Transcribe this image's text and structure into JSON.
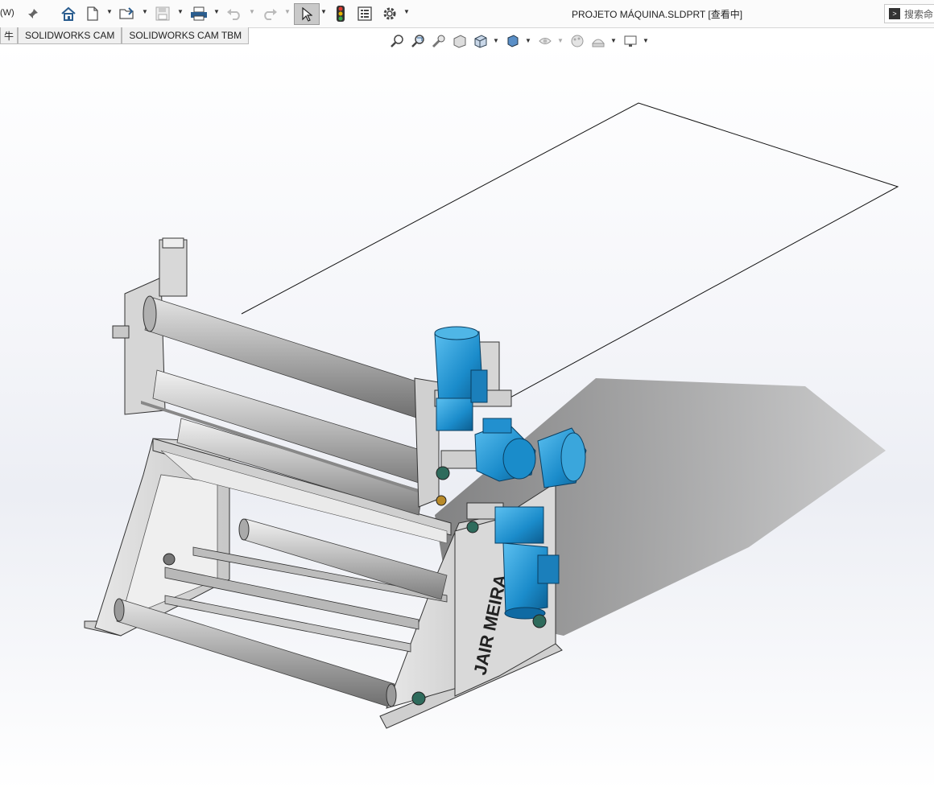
{
  "app": {
    "menu_fragment": "(W)",
    "document_title": "PROJETO MÁQUINA.SLDPRT [查看中]",
    "search_placeholder": "搜索命"
  },
  "tabs": [
    {
      "label": "牛"
    },
    {
      "label": "SOLIDWORKS CAM"
    },
    {
      "label": "SOLIDWORKS CAM TBM"
    }
  ],
  "toolbar_icons": [
    "pin-icon",
    "home-icon",
    "new-document-icon",
    "open-folder-icon",
    "save-icon",
    "print-icon",
    "undo-icon",
    "redo-icon",
    "select-cursor-icon",
    "rebuild-traffic-light-icon",
    "file-properties-icon",
    "options-gear-icon"
  ],
  "heads_up_toolbar_icons": [
    "zoom-to-fit-icon",
    "zoom-to-area-icon",
    "previous-view-icon",
    "section-view-icon",
    "view-orientation-icon",
    "display-style-icon",
    "hide-show-items-icon",
    "edit-appearance-icon",
    "apply-scene-icon",
    "view-settings-icon"
  ],
  "model": {
    "engraved_label": "JAIR MEIRA",
    "colors": {
      "frame": "#d8d8d8",
      "roller": "#c4c4c4",
      "motor": "#1e8fcf",
      "shadow": "#8c8c8c"
    }
  }
}
